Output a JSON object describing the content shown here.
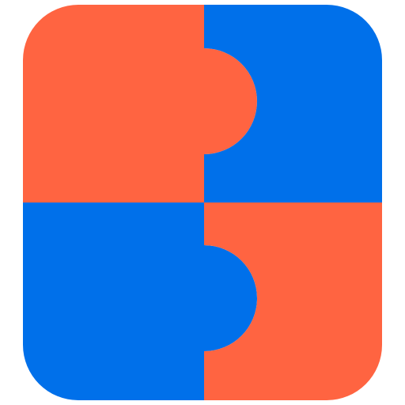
{
  "logo": {
    "colors": {
      "orange": "#FF6441",
      "blue": "#0070EA"
    },
    "icon_name": "puzzle-pieces-icon"
  }
}
